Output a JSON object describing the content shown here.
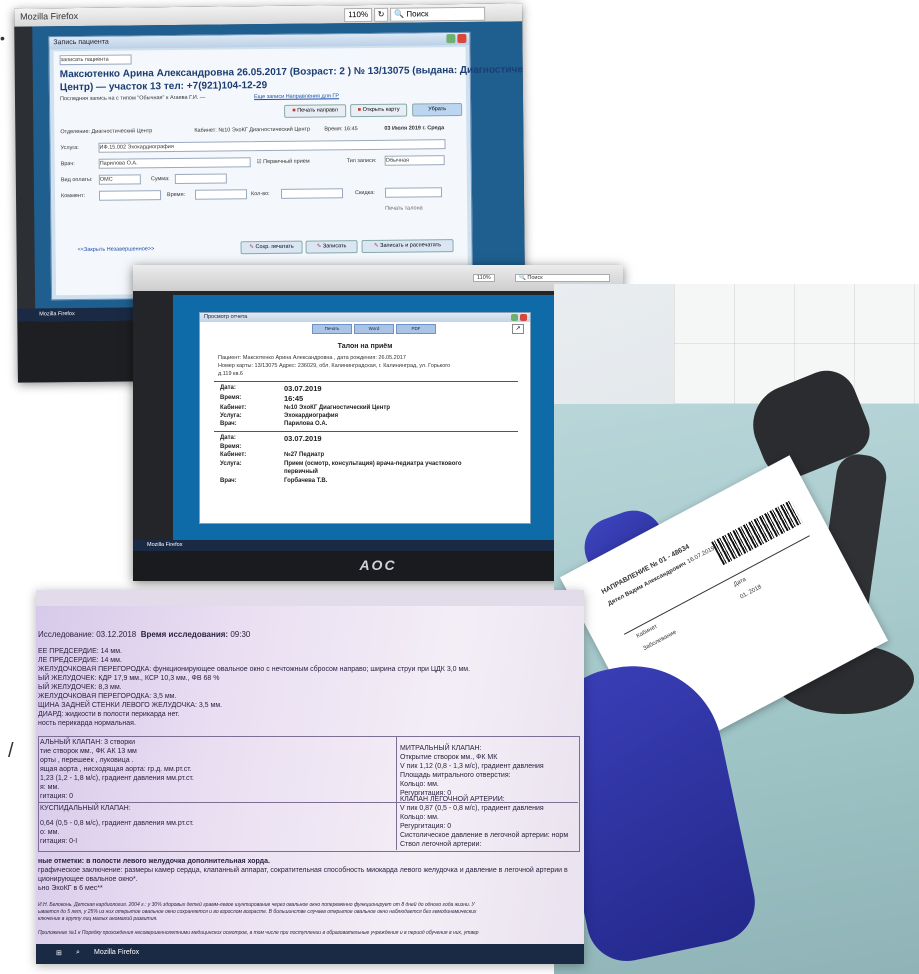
{
  "photo1": {
    "browser_title": "Mozilla Firefox",
    "browser_zoom": "110%",
    "browser_search": "Поиск",
    "dialog_title": "Запись пациента",
    "dropdown_value": "записать пациента",
    "patient_header_1": "Максютенко Арина Александровна 26.05.2017 (Возраст: 2 ) № 13/13075 (выдана: Диагностический",
    "patient_header_2": "Центр) — участок 13 тел: +7(921)104-12-29",
    "last_record": "Последняя запись на с типом \"Обычная\" к Агаева Г.И. —",
    "links": "Еще записи Направления для ГР",
    "btn_print_directions": "Печать направл",
    "btn_open_card": "Открыть карту",
    "btn_close": "Убрать",
    "label_department": "Отделение: Диагностический Центр",
    "label_cabinet": "Кабинет: №10 ЭхоКГ Диагностический Центр",
    "label_time": "Время: 16:45",
    "label_date": "03 Июля 2019 г. Среда",
    "label_service": "Услуга:",
    "value_service": "ИФ.15.002 Эхокардиография",
    "label_doctor": "Врач:",
    "value_doctor": "Парилова О.А.",
    "checkbox_primary": "Первичный прием",
    "label_record_type": "Тип записи:",
    "value_record_type": "Обычная",
    "label_payment": "Вид оплаты:",
    "value_payment": "ОМС",
    "label_sum": "Сумма:",
    "label_comment": "Коммент:",
    "label_time2": "Время:",
    "label_quantity": "Кол-во:",
    "label_discount": "Скидка:",
    "print_form": "Печать талона",
    "link_bottom": "<<Закрыть Незавершенное>>",
    "btn_save_print": "Сохр. печатать",
    "btn_save": "Записать",
    "btn_save_print_more": "Записать и распечатать",
    "taskbar_app": "Mozilla Firefox"
  },
  "photo2": {
    "browser_zoom": "110%",
    "browser_search": "Поиск",
    "window_title": "Просмотр отчета",
    "btn_print": "Печать",
    "btn_word": "Word",
    "btn_pdf": "PDF",
    "title": "Талон на приём",
    "patient_line": "Пациент: Максютенко Арина Александровна , дата рождения: 26.05.2017",
    "card_line": "Номер карты: 13/13075 Адрес: 236029, обл. Калининградская, г. Калининград, ул. Горького",
    "card_line_2": "д.119 кв.6",
    "block1": {
      "date_label": "Дата:",
      "date_value": "03.07.2019",
      "time_label": "Время:",
      "time_value": "16:45",
      "cabinet_label": "Кабинет:",
      "cabinet_value": "№10 ЭхоКГ Диагностический Центр",
      "service_label": "Услуга:",
      "service_value": "Эхокардиография",
      "doctor_label": "Врач:",
      "doctor_value": "Парилова О.А."
    },
    "block2": {
      "date_label": "Дата:",
      "date_value": "03.07.2019",
      "time_label": "Время:",
      "cabinet_label": "Кабинет:",
      "cabinet_value": "№27 Педиатр",
      "service_label": "Услуга:",
      "service_value": "Прием (осмотр, консультация) врача-педиатра участкового",
      "service_value_2": "первичный",
      "doctor_label": "Врач:",
      "doctor_value": "Горбачева Т.В."
    },
    "monitor_brand": "AOC",
    "taskbar_app": "Mozilla Firefox"
  },
  "photo3": {
    "paper_title": "НАПРАВЛЕНИЕ № 01 - 48634",
    "paper_patient": "Дятел Вадим Александрович",
    "paper_date": "16.07.2019",
    "paper_cab": "Кабинет",
    "paper_date2": "Дата",
    "paper_year": "01. 2018",
    "paper_line": "Заболевание"
  },
  "photo4": {
    "date_line_label": "Исследование:",
    "date_line_value": "03.12.2018",
    "time_label": "Время исследования:",
    "time_value": "09:30",
    "lines": [
      "ЕЕ ПРЕДСЕРДИЕ: 14 мм.",
      "ЛЕ ПРЕДСЕРДИЕ: 14 мм.",
      "ЖЕЛУДОЧКОВАЯ ПЕРЕГОРОДКА: функционирующее овальное окно с нечтожным сбросом направо; ширина струи при ЦДК 3,0 мм.",
      "ЫЙ ЖЕЛУДОЧЕК: КДР 17,9 мм., КСР 10,3 мм., ФВ 68 %",
      "ЫЙ ЖЕЛУДОЧЕК: 8,3 мм.",
      "ЖЕЛУДОЧКОВАЯ ПЕРЕГОРОДКА: 3,5 мм.",
      "ЩИНА ЗАДНЕЙ СТЕНКИ ЛЕВОГО ЖЕЛУДОЧКА: 3,5 мм.",
      "ДИАРД: жидкости в полости перикарда нет.",
      "ность перикарда нормальная."
    ],
    "left_col": [
      "АЛЬНЫЙ КЛАПАН: 3 створки",
      "тие створок  мм., ФК АК 13 мм",
      "орты  , перешеек  , луковица  .",
      "ящая аорта  , нисходящая аорта: гр.д.  мм.рт.ст.",
      "1,23  (1,2 - 1,8 м/с), градиент давления    мм.рт.ст.",
      "я:  мм.",
      "гитация: 0"
    ],
    "right_col": [
      "МИТРАЛЬНЫЙ КЛАПАН:",
      "Открытие створок   мм., ФК МК",
      "V пик 1,12   (0,8 - 1,3 м/с), градиент давления",
      "Площадь митрального отверстия:",
      "Кольцо:  мм.",
      "Регургитация: 0"
    ],
    "left_col2": [
      "КУСПИДАЛЬНЫЙ КЛАПАН:",
      "0,64  (0,5 - 0,8 м/с), градиент давления    мм.рт.ст.",
      "о:  мм.",
      "гитация: 0-I"
    ],
    "right_col2": [
      "КЛАПАН ЛЕГОЧНОЙ АРТЕРИИ:",
      "V пик 0,87  (0,5 - 0,8 м/с), градиент давления",
      "Кольцо:  мм.",
      "Регургитация: 0",
      "Систолическое давление в легочной артерии: норм",
      "Ствол легочной артерии:"
    ],
    "footer_lines": [
      "ные отметки: в полости левого желудочка дополнительная хорда.",
      "графическое заключение: размеры камер сердца, клапанный аппарат, сократительная способность миокарда левого желудочка и давление в легочной артерии в",
      "ционирующее овальное окно*.",
      "ьно ЭхоКГ в 6 мес**"
    ],
    "note_lines": [
      "И.Н. Белоконь. Детская кардиология. 2004 г.: у 30% здоровых детей грамм-левое шунтирование через овальное окно попеременно функционирует от 8 дней до одного года жизни. У",
      "ывается до 5 лет, у 25% из них открытое овальное окно сохраняется и во взрослом возрасте. В большинстве случаев открытое овальное окно наблюдается без гемодинамических",
      "ключение в группу лиц малых аномалий развития."
    ],
    "note_last": "Приложение №1 к Порядку прохождения несовершеннолетними медицинских осмотров, в том числе при поступлении в образовательные учреждения и в период обучения в них, утвер",
    "taskbar_app": "Mozilla Firefox"
  }
}
